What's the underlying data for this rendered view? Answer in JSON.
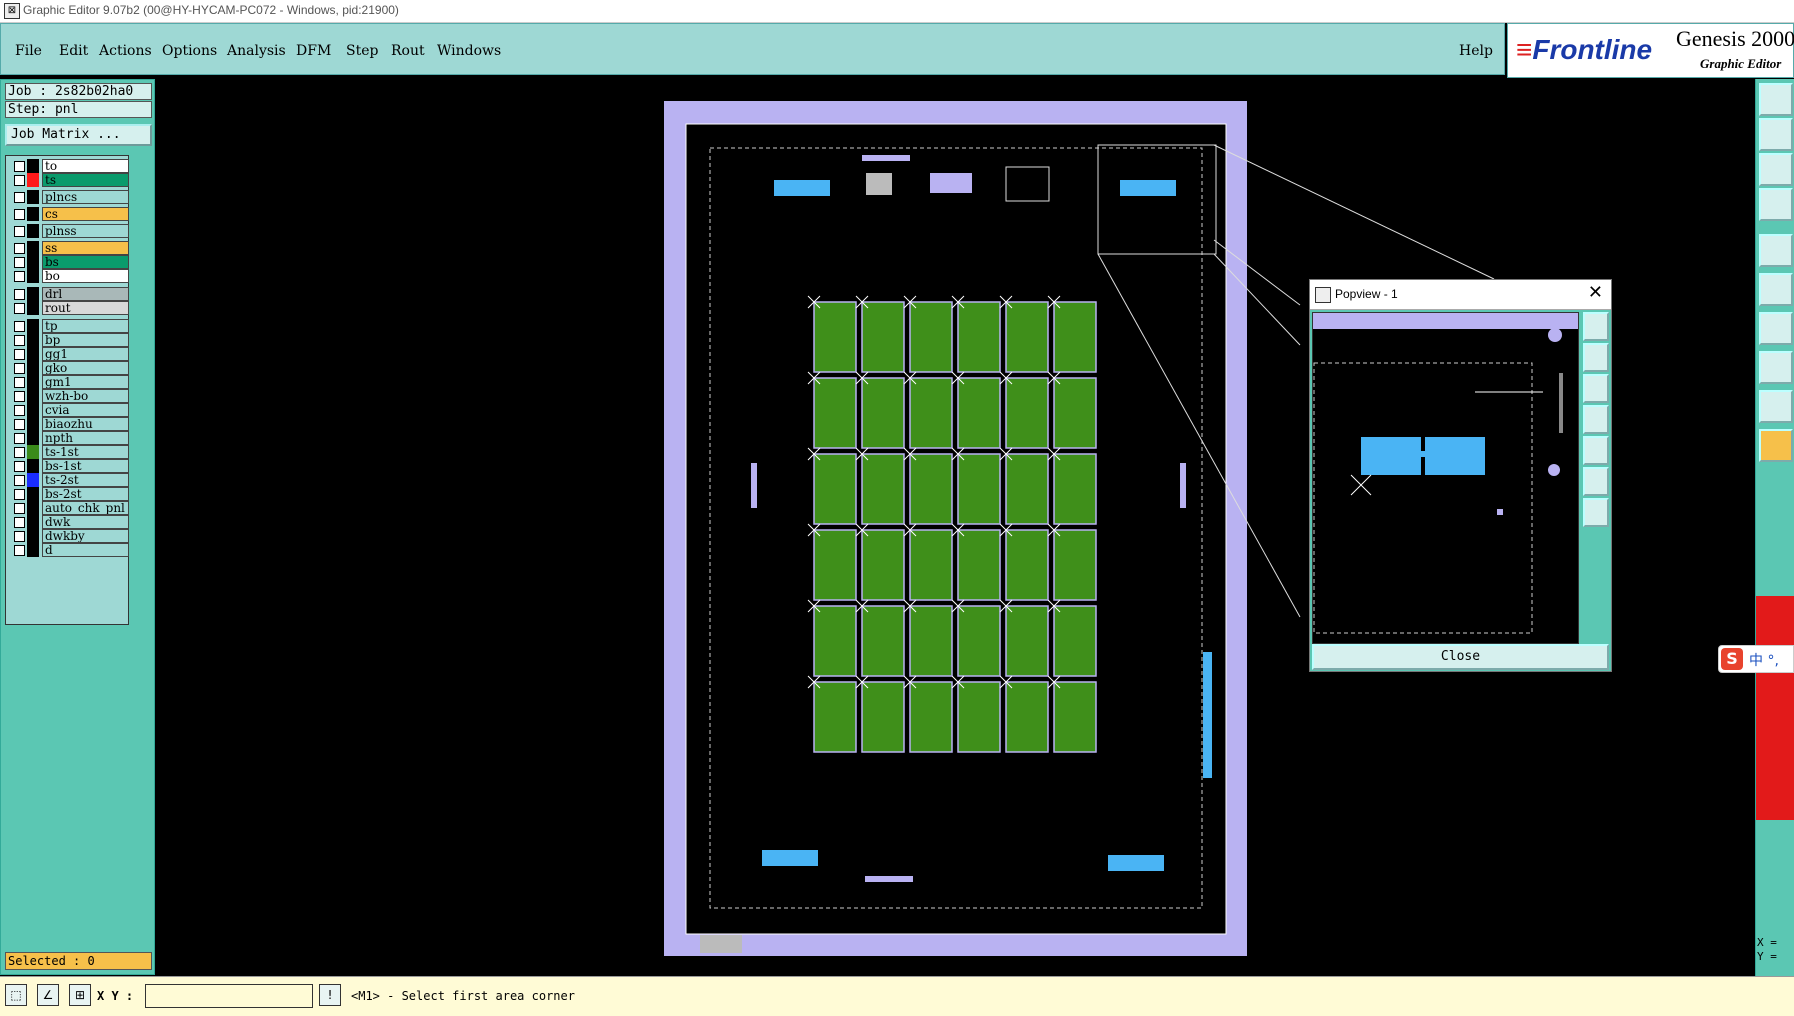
{
  "window": {
    "title": "Graphic Editor 9.07b2 (00@HY-HYCAM-PC072 - Windows, pid:21900)"
  },
  "menu": {
    "items": [
      "File",
      "Edit",
      "Actions",
      "Options",
      "Analysis",
      "DFM",
      "Step",
      "Rout",
      "Windows"
    ],
    "help": "Help"
  },
  "brand": {
    "logo": "Frontline",
    "product": "Genesis 2000",
    "subtitle": "Graphic Editor"
  },
  "job": {
    "job_line": "Job : 2s82b02ha0",
    "step_line": "Step: pnl",
    "matrix_button": "Job Matrix ..."
  },
  "layers": [
    {
      "name": "to",
      "color": "#ffffff",
      "swatch": "#000000"
    },
    {
      "name": "ts",
      "color": "#0a9b6c",
      "swatch": "#ff1a1a",
      "active": true
    },
    {
      "name": "plncs",
      "color": "#9ed8d4",
      "swatch": "#000000"
    },
    {
      "name": "cs",
      "color": "#f6c04a",
      "swatch": "#000000"
    },
    {
      "name": "plnss",
      "color": "#9ed8d4",
      "swatch": "#000000"
    },
    {
      "name": "ss",
      "color": "#f6c04a",
      "swatch": "#000000"
    },
    {
      "name": "bs",
      "color": "#0a9b6c",
      "swatch": "#000000"
    },
    {
      "name": "bo",
      "color": "#ffffff",
      "swatch": "#000000"
    },
    {
      "name": "drl",
      "color": "#a9b8b8",
      "swatch": "#000000"
    },
    {
      "name": "rout",
      "color": "#d8d8d8",
      "swatch": "#000000"
    },
    {
      "name": "tp",
      "color": "#9ed8d4",
      "swatch": "#000000"
    },
    {
      "name": "bp",
      "color": "#9ed8d4",
      "swatch": "#000000"
    },
    {
      "name": "gg1",
      "color": "#9ed8d4",
      "swatch": "#000000"
    },
    {
      "name": "gko",
      "color": "#9ed8d4",
      "swatch": "#000000"
    },
    {
      "name": "gm1",
      "color": "#9ed8d4",
      "swatch": "#000000"
    },
    {
      "name": "wzh-bo",
      "color": "#9ed8d4",
      "swatch": "#000000"
    },
    {
      "name": "cvia",
      "color": "#9ed8d4",
      "swatch": "#000000"
    },
    {
      "name": "biaozhu",
      "color": "#9ed8d4",
      "swatch": "#000000"
    },
    {
      "name": "npth",
      "color": "#9ed8d4",
      "swatch": "#000000"
    },
    {
      "name": "ts-1st",
      "color": "#9ed8d4",
      "swatch": "#3a8a1a"
    },
    {
      "name": "bs-1st",
      "color": "#9ed8d4",
      "swatch": "#000000"
    },
    {
      "name": "ts-2st",
      "color": "#9ed8d4",
      "swatch": "#1a2cff"
    },
    {
      "name": "bs-2st",
      "color": "#9ed8d4",
      "swatch": "#000000"
    },
    {
      "name": "auto_chk_pnl",
      "color": "#9ed8d4",
      "swatch": "#000000"
    },
    {
      "name": "dwk",
      "color": "#9ed8d4",
      "swatch": "#000000"
    },
    {
      "name": "dwkby",
      "color": "#9ed8d4",
      "swatch": "#000000"
    },
    {
      "name": "d",
      "color": "#9ed8d4",
      "swatch": "#000000"
    }
  ],
  "selected": "Selected : 0",
  "status": {
    "xy_label": "X Y :",
    "xy_value": "",
    "prompt": "<M1> - Select first area corner"
  },
  "coords": {
    "x": "X =",
    "y": "Y ="
  },
  "popview": {
    "title": "Popview - 1",
    "close_button": "Close",
    "close_x": "✕"
  },
  "ime": {
    "logo": "S",
    "text": "中 °,"
  },
  "pcb_grid": {
    "rows": 6,
    "cols": 6
  }
}
